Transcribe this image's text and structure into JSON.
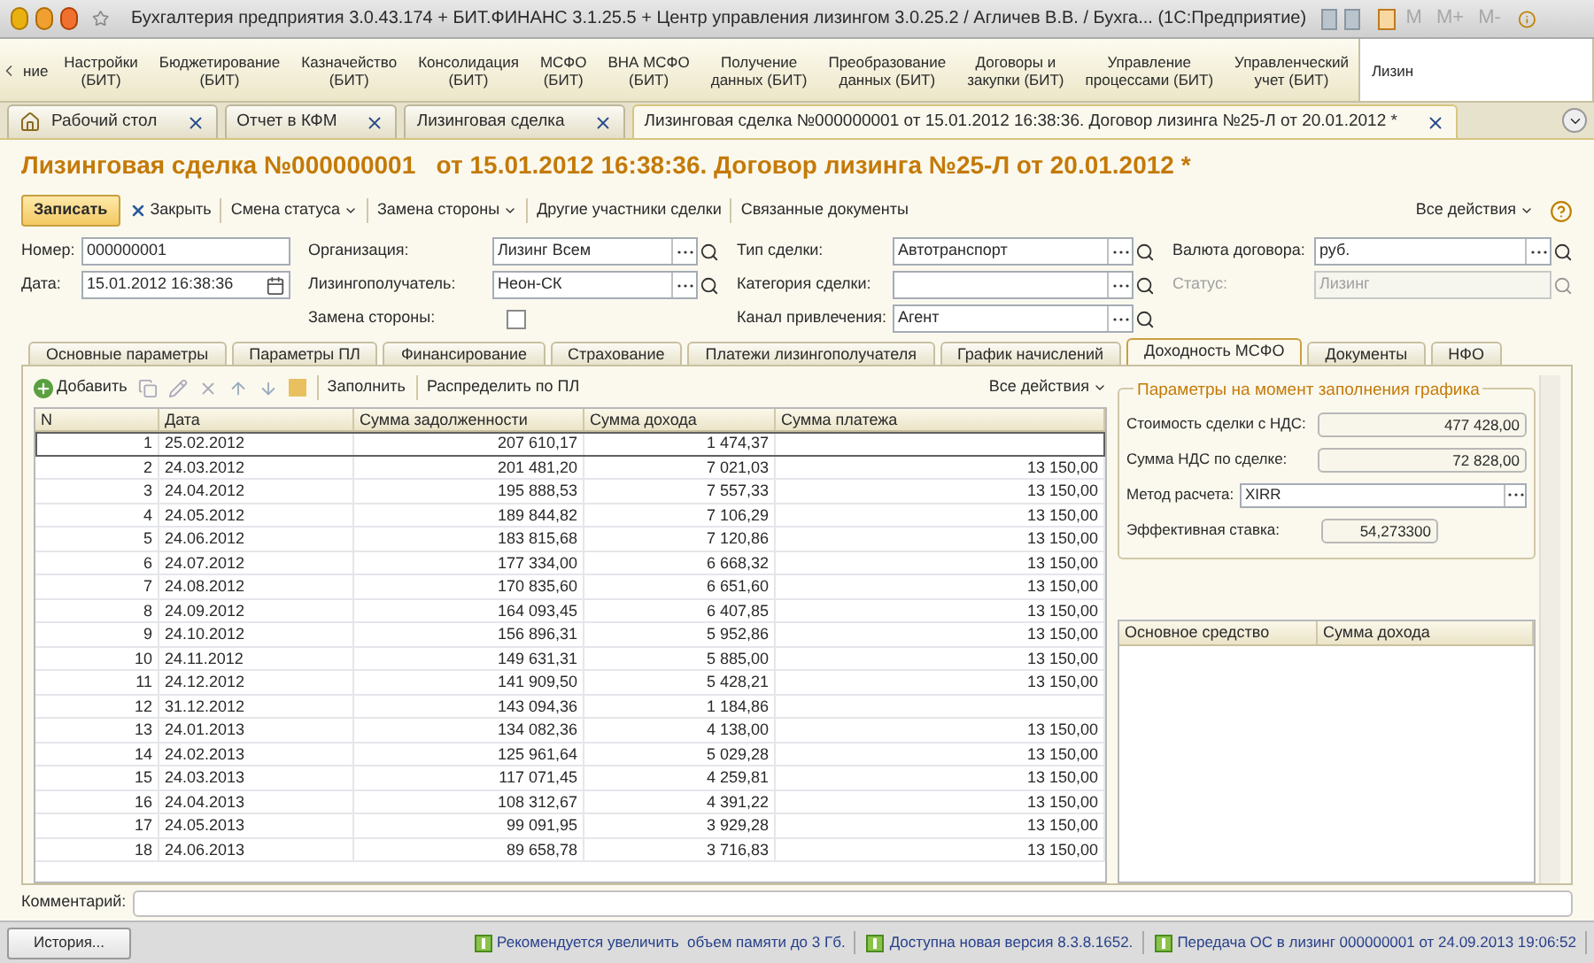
{
  "titlebar": {
    "title": "Бухгалтерия предприятия 3.0.43.174 + БИТ.ФИНАНС 3.1.25.5 + Центр управления лизингом 3.0.25.2 / Агличев В.В. / Бухга...  (1С:Предприятие)",
    "memory_buttons": [
      "M",
      "M+",
      "M-"
    ]
  },
  "sections": [
    {
      "label": "ние",
      "selected": false
    },
    {
      "label": "Настройки\n(БИТ)",
      "selected": false
    },
    {
      "label": "Бюджетирование\n(БИТ)",
      "selected": false
    },
    {
      "label": "Казначейство\n(БИТ)",
      "selected": false
    },
    {
      "label": "Консолидация\n(БИТ)",
      "selected": false
    },
    {
      "label": "МСФО\n(БИТ)",
      "selected": false
    },
    {
      "label": "ВНА МСФО\n(БИТ)",
      "selected": false
    },
    {
      "label": "Получение\nданных (БИТ)",
      "selected": false
    },
    {
      "label": "Преобразование\nданных (БИТ)",
      "selected": false
    },
    {
      "label": "Договоры и\nзакупки (БИТ)",
      "selected": false
    },
    {
      "label": "Управление\nпроцессами (БИТ)",
      "selected": false
    },
    {
      "label": "Управленческий\nучет (БИТ)",
      "selected": false
    },
    {
      "label": "Лизин",
      "selected": true
    }
  ],
  "window_tabs": [
    {
      "label": "Рабочий стол",
      "kind": "home",
      "selected": false
    },
    {
      "label": "Отчет в КФМ",
      "kind": "plain",
      "selected": false
    },
    {
      "label": "Лизинговая сделка",
      "kind": "plain",
      "selected": false
    },
    {
      "label": "Лизинговая сделка №000000001  от 15.01.2012 16:38:36. Договор лизинга №25-Л от 20.01.2012 *",
      "kind": "plain",
      "selected": true
    }
  ],
  "form": {
    "title": "Лизинговая сделка №000000001   от 15.01.2012 16:38:36. Договор лизинга №25-Л от 20.01.2012 *",
    "toolbar": [
      {
        "label": "Записать",
        "kind": "primary"
      },
      {
        "label": "Закрыть",
        "kind": "close"
      },
      {
        "label": "Смена статуса",
        "kind": "menu"
      },
      {
        "label": "Замена стороны",
        "kind": "menu"
      },
      {
        "label": "Другие участники сделки",
        "kind": "plain"
      },
      {
        "label": "Связанные документы",
        "kind": "plain"
      }
    ],
    "all_actions": "Все действия",
    "columns": [
      [
        {
          "label": "Номер:",
          "value": "000000001",
          "kind": "text",
          "disabled": false
        },
        {
          "label": "Дата:",
          "value": "15.01.2012 16:38:36",
          "kind": "date",
          "disabled": false
        }
      ],
      [
        {
          "label": "Организация:",
          "value": "Лизинг Всем",
          "kind": "ref",
          "disabled": false
        },
        {
          "label": "Лизингополучатель:",
          "value": "Неон-СК",
          "kind": "ref",
          "disabled": false
        },
        {
          "label": "Замена стороны:",
          "kind": "checkbox",
          "checked": false
        }
      ],
      [
        {
          "label": "Тип сделки:",
          "value": "Автотранспорт",
          "kind": "ref",
          "disabled": false
        },
        {
          "label": "Категория сделки:",
          "kind": "ref",
          "disabled": false
        },
        {
          "label": "Канал привлечения:",
          "value": "Агент",
          "kind": "ref",
          "disabled": false
        }
      ],
      [
        {
          "label": "Валюта договора:",
          "value": "руб.",
          "kind": "ref",
          "disabled": false
        },
        {
          "label": "Статус:",
          "value": "Лизинг",
          "kind": "search",
          "disabled": true
        }
      ]
    ]
  },
  "tabs": [
    {
      "label": "Основные параметры",
      "selected": false
    },
    {
      "label": "Параметры ПЛ",
      "selected": false
    },
    {
      "label": "Финансирование",
      "selected": false
    },
    {
      "label": "Страхование",
      "selected": false
    },
    {
      "label": "Платежи лизингополучателя",
      "selected": false
    },
    {
      "label": "График начислений",
      "selected": false
    },
    {
      "label": "Доходность МСФО",
      "selected": true
    },
    {
      "label": "Документы",
      "selected": false
    },
    {
      "label": "НФО",
      "selected": false
    }
  ],
  "table_toolbar": {
    "add": "Добавить",
    "fill": "Заполнить",
    "distribute": "Распределить по ПЛ",
    "all_actions": "Все действия"
  },
  "table": {
    "columns": [
      "N",
      "Дата",
      "Сумма задолженности",
      "Сумма дохода",
      "Сумма платежа"
    ],
    "rows": [
      {
        "cells": [
          "1",
          "25.02.2012",
          "207 610,17",
          "1 474,37",
          ""
        ],
        "selected": true
      },
      {
        "cells": [
          "2",
          "24.03.2012",
          "201 481,20",
          "7 021,03",
          "13 150,00"
        ],
        "selected": false
      },
      {
        "cells": [
          "3",
          "24.04.2012",
          "195 888,53",
          "7 557,33",
          "13 150,00"
        ],
        "selected": false
      },
      {
        "cells": [
          "4",
          "24.05.2012",
          "189 844,82",
          "7 106,29",
          "13 150,00"
        ],
        "selected": false
      },
      {
        "cells": [
          "5",
          "24.06.2012",
          "183 815,68",
          "7 120,86",
          "13 150,00"
        ],
        "selected": false
      },
      {
        "cells": [
          "6",
          "24.07.2012",
          "177 334,00",
          "6 668,32",
          "13 150,00"
        ],
        "selected": false
      },
      {
        "cells": [
          "7",
          "24.08.2012",
          "170 835,60",
          "6 651,60",
          "13 150,00"
        ],
        "selected": false
      },
      {
        "cells": [
          "8",
          "24.09.2012",
          "164 093,45",
          "6 407,85",
          "13 150,00"
        ],
        "selected": false
      },
      {
        "cells": [
          "9",
          "24.10.2012",
          "156 896,31",
          "5 952,86",
          "13 150,00"
        ],
        "selected": false
      },
      {
        "cells": [
          "10",
          "24.11.2012",
          "149 631,31",
          "5 885,00",
          "13 150,00"
        ],
        "selected": false
      },
      {
        "cells": [
          "11",
          "24.12.2012",
          "141 909,50",
          "5 428,21",
          "13 150,00"
        ],
        "selected": false
      },
      {
        "cells": [
          "12",
          "31.12.2012",
          "143 094,36",
          "1 184,86",
          ""
        ],
        "selected": false
      },
      {
        "cells": [
          "13",
          "24.01.2013",
          "134 082,36",
          "4 138,00",
          "13 150,00"
        ],
        "selected": false
      },
      {
        "cells": [
          "14",
          "24.02.2013",
          "125 961,64",
          "5 029,28",
          "13 150,00"
        ],
        "selected": false
      },
      {
        "cells": [
          "15",
          "24.03.2013",
          "117 071,45",
          "4 259,81",
          "13 150,00"
        ],
        "selected": false
      },
      {
        "cells": [
          "16",
          "24.04.2013",
          "108 312,67",
          "4 391,22",
          "13 150,00"
        ],
        "selected": false
      },
      {
        "cells": [
          "17",
          "24.05.2013",
          "99 091,95",
          "3 929,28",
          "13 150,00"
        ],
        "selected": false
      },
      {
        "cells": [
          "18",
          "24.06.2013",
          "89 658,78",
          "3 716,83",
          "13 150,00"
        ],
        "selected": false
      }
    ]
  },
  "params": {
    "title": "Параметры на момент заполнения графика",
    "fields": [
      {
        "label": "Стоимость сделки с НДС:",
        "value": "477 428,00",
        "kind": "number"
      },
      {
        "label": "Сумма НДС по сделке:",
        "value": "72 828,00",
        "kind": "number"
      },
      {
        "label": "Метод расчета:",
        "value": "XIRR",
        "kind": "choice"
      },
      {
        "label": "Эффективная ставка:",
        "value": "54,273300",
        "kind": "number"
      }
    ]
  },
  "assets_table": {
    "columns": [
      "Основное средство",
      "Сумма дохода"
    ]
  },
  "comment": {
    "label": "Комментарий:"
  },
  "status_bar": {
    "history": "История...",
    "messages": [
      "Рекомендуется увеличить  объем памяти до 3 Гб.",
      "Доступна новая версия 8.3.8.1652.",
      "Передача ОС в лизинг 000000001 от 24.09.2013 19:06:52"
    ]
  }
}
